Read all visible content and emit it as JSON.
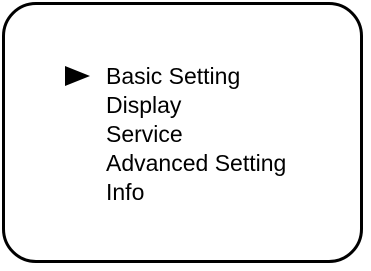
{
  "menu": {
    "selected_index": 0,
    "selector_icon": "triangle-right-icon",
    "items": [
      {
        "label": "Basic Setting"
      },
      {
        "label": "Display"
      },
      {
        "label": "Service"
      },
      {
        "label": "Advanced Setting"
      },
      {
        "label": "Info"
      }
    ]
  }
}
